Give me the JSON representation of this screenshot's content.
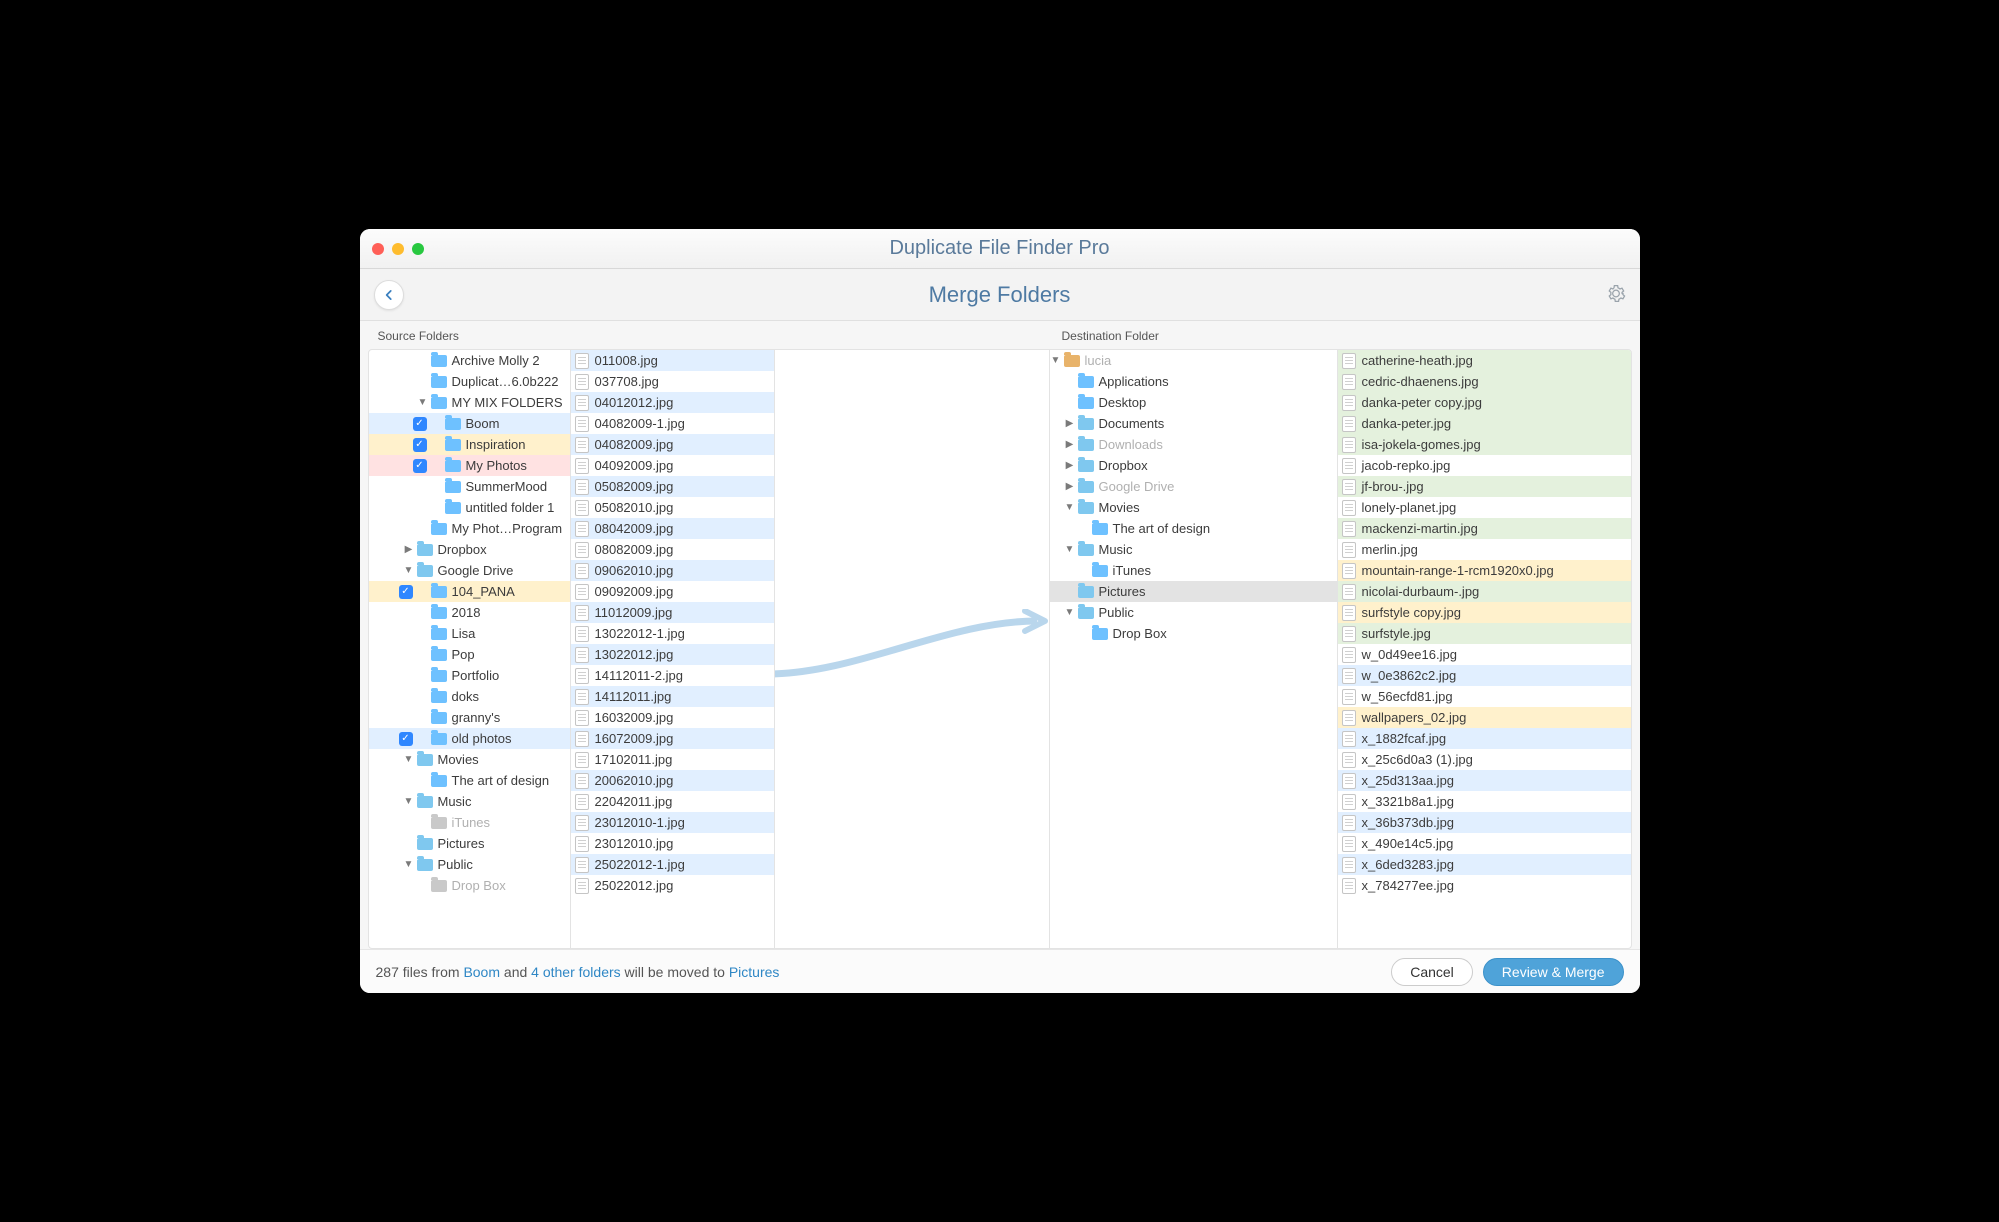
{
  "app_title": "Duplicate File Finder Pro",
  "sub_title": "Merge Folders",
  "label_source": "Source Folders",
  "label_dest": "Destination Folder",
  "source_tree": [
    {
      "depth": 2,
      "icon": "blue",
      "label": "Archive Molly 2"
    },
    {
      "depth": 2,
      "icon": "blue",
      "label": "Duplicat…6.0b222"
    },
    {
      "depth": 2,
      "tri": "down",
      "icon": "blue",
      "label": "MY MIX FOLDERS"
    },
    {
      "depth": 3,
      "check": true,
      "icon": "blue",
      "label": "Boom",
      "hl": "blue"
    },
    {
      "depth": 3,
      "check": true,
      "icon": "blue",
      "label": "Inspiration",
      "hl": "yellow"
    },
    {
      "depth": 3,
      "check": true,
      "icon": "blue",
      "label": "My Photos",
      "hl": "red"
    },
    {
      "depth": 3,
      "icon": "blue",
      "label": "SummerMood"
    },
    {
      "depth": 3,
      "icon": "blue",
      "label": "untitled folder 1"
    },
    {
      "depth": 2,
      "icon": "blue",
      "label": "My Phot…Program"
    },
    {
      "depth": 1,
      "tri": "right",
      "icon": "drive",
      "label": "Dropbox"
    },
    {
      "depth": 1,
      "tri": "down",
      "icon": "drive",
      "label": "Google Drive"
    },
    {
      "depth": 2,
      "check": true,
      "icon": "blue",
      "label": "104_PANA",
      "hl": "yellow"
    },
    {
      "depth": 2,
      "icon": "blue",
      "label": "2018"
    },
    {
      "depth": 2,
      "icon": "blue",
      "label": "Lisa"
    },
    {
      "depth": 2,
      "icon": "blue",
      "label": "Pop"
    },
    {
      "depth": 2,
      "icon": "blue",
      "label": "Portfolio"
    },
    {
      "depth": 2,
      "icon": "blue",
      "label": "doks"
    },
    {
      "depth": 2,
      "icon": "blue",
      "label": "granny's"
    },
    {
      "depth": 2,
      "check": true,
      "icon": "blue",
      "label": "old photos",
      "hl": "blue"
    },
    {
      "depth": 1,
      "tri": "down",
      "icon": "drive",
      "label": "Movies"
    },
    {
      "depth": 2,
      "icon": "blue",
      "label": "The art of design"
    },
    {
      "depth": 1,
      "tri": "down",
      "icon": "drive",
      "label": "Music"
    },
    {
      "depth": 2,
      "icon": "gray",
      "label": "iTunes",
      "dim": true
    },
    {
      "depth": 1,
      "icon": "drive",
      "label": "Pictures"
    },
    {
      "depth": 1,
      "tri": "down",
      "icon": "drive",
      "label": "Public"
    },
    {
      "depth": 2,
      "icon": "gray",
      "label": "Drop Box",
      "dim": true
    }
  ],
  "source_files": [
    {
      "label": "011008.jpg",
      "hl": "blue"
    },
    {
      "label": "037708.jpg"
    },
    {
      "label": "04012012.jpg",
      "hl": "blue"
    },
    {
      "label": "04082009-1.jpg"
    },
    {
      "label": "04082009.jpg",
      "hl": "blue"
    },
    {
      "label": "04092009.jpg"
    },
    {
      "label": "05082009.jpg",
      "hl": "blue"
    },
    {
      "label": "05082010.jpg"
    },
    {
      "label": "08042009.jpg",
      "hl": "blue"
    },
    {
      "label": "08082009.jpg"
    },
    {
      "label": "09062010.jpg",
      "hl": "blue"
    },
    {
      "label": "09092009.jpg"
    },
    {
      "label": "11012009.jpg",
      "hl": "blue"
    },
    {
      "label": "13022012-1.jpg"
    },
    {
      "label": "13022012.jpg",
      "hl": "blue"
    },
    {
      "label": "14112011-2.jpg"
    },
    {
      "label": "14112011.jpg",
      "hl": "blue"
    },
    {
      "label": "16032009.jpg"
    },
    {
      "label": "16072009.jpg",
      "hl": "blue"
    },
    {
      "label": "17102011.jpg"
    },
    {
      "label": "20062010.jpg",
      "hl": "blue"
    },
    {
      "label": "22042011.jpg"
    },
    {
      "label": "23012010-1.jpg",
      "hl": "blue"
    },
    {
      "label": "23012010.jpg"
    },
    {
      "label": "25022012-1.jpg",
      "hl": "blue"
    },
    {
      "label": "25022012.jpg"
    }
  ],
  "dest_tree": [
    {
      "depth": 0,
      "tri": "down",
      "icon": "home",
      "label": "lucia",
      "dim": true
    },
    {
      "depth": 1,
      "icon": "blue",
      "label": "Applications"
    },
    {
      "depth": 1,
      "icon": "blue",
      "label": "Desktop"
    },
    {
      "depth": 1,
      "tri": "right",
      "icon": "drive",
      "label": "Documents"
    },
    {
      "depth": 1,
      "tri": "right",
      "icon": "drive",
      "label": "Downloads",
      "dim": true
    },
    {
      "depth": 1,
      "tri": "right",
      "icon": "drive",
      "label": "Dropbox"
    },
    {
      "depth": 1,
      "tri": "right",
      "icon": "drive",
      "label": "Google Drive",
      "dim": true
    },
    {
      "depth": 1,
      "tri": "down",
      "icon": "drive",
      "label": "Movies"
    },
    {
      "depth": 2,
      "icon": "blue",
      "label": "The art of design"
    },
    {
      "depth": 1,
      "tri": "down",
      "icon": "drive",
      "label": "Music"
    },
    {
      "depth": 2,
      "icon": "blue",
      "label": "iTunes"
    },
    {
      "depth": 1,
      "icon": "drive",
      "label": "Pictures",
      "sel": true
    },
    {
      "depth": 1,
      "tri": "down",
      "icon": "drive",
      "label": "Public"
    },
    {
      "depth": 2,
      "icon": "blue",
      "label": "Drop Box"
    }
  ],
  "dest_files": [
    {
      "label": "catherine-heath.jpg",
      "hl": "green"
    },
    {
      "label": "cedric-dhaenens.jpg",
      "hl": "green"
    },
    {
      "label": "danka-peter copy.jpg",
      "hl": "green"
    },
    {
      "label": "danka-peter.jpg",
      "hl": "green"
    },
    {
      "label": "isa-jokela-gomes.jpg",
      "hl": "green"
    },
    {
      "label": "jacob-repko.jpg"
    },
    {
      "label": "jf-brou-.jpg",
      "hl": "green"
    },
    {
      "label": "lonely-planet.jpg"
    },
    {
      "label": "mackenzi-martin.jpg",
      "hl": "green"
    },
    {
      "label": "merlin.jpg"
    },
    {
      "label": "mountain-range-1-rcm1920x0.jpg",
      "hl": "yellow"
    },
    {
      "label": "nicolai-durbaum-.jpg",
      "hl": "green"
    },
    {
      "label": "surfstyle copy.jpg",
      "hl": "yellow"
    },
    {
      "label": "surfstyle.jpg",
      "hl": "green"
    },
    {
      "label": "w_0d49ee16.jpg"
    },
    {
      "label": "w_0e3862c2.jpg",
      "hl": "blue"
    },
    {
      "label": "w_56ecfd81.jpg"
    },
    {
      "label": "wallpapers_02.jpg",
      "hl": "yellow"
    },
    {
      "label": "x_1882fcaf.jpg",
      "hl": "blue"
    },
    {
      "label": "x_25c6d0a3 (1).jpg"
    },
    {
      "label": "x_25d313aa.jpg",
      "hl": "blue"
    },
    {
      "label": "x_3321b8a1.jpg"
    },
    {
      "label": "x_36b373db.jpg",
      "hl": "blue"
    },
    {
      "label": "x_490e14c5.jpg"
    },
    {
      "label": "x_6ded3283.jpg",
      "hl": "blue"
    },
    {
      "label": "x_784277ee.jpg"
    }
  ],
  "footer": {
    "count": "287",
    "t1": " files from ",
    "src": "Boom",
    "t2": " and ",
    "others": "4 other folders",
    "t3": " will be moved to ",
    "dst": "Pictures"
  },
  "buttons": {
    "cancel": "Cancel",
    "merge": "Review & Merge"
  }
}
